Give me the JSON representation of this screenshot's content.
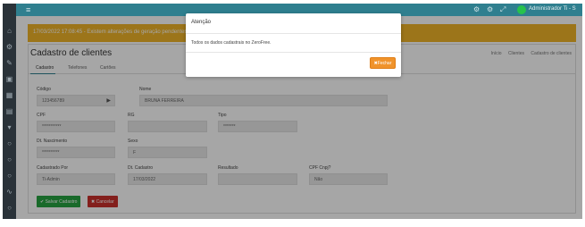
{
  "header": {
    "user_name": "Administrador Ti - S"
  },
  "banner": {
    "text": "17/03/2022 17:08:45 - Existem alterações de geração pendentes no sistema"
  },
  "page": {
    "title": "Cadastro de clientes",
    "breadcrumb": [
      "Início",
      "Clientes",
      "Cadastro de clientes"
    ]
  },
  "tabs": [
    "Cadastro",
    "Telefones",
    "Cartões"
  ],
  "form": {
    "codigo": {
      "label": "Código",
      "value": "123456789"
    },
    "nome": {
      "label": "Nome",
      "value": "BRUNA FERREIRA"
    },
    "cpf": {
      "label": "CPF",
      "value": "***********"
    },
    "rg": {
      "label": "RG",
      "value": ""
    },
    "tipo": {
      "label": "Tipo",
      "value": "*******"
    },
    "nascimento": {
      "label": "Dt. Nascimento",
      "value": "**********"
    },
    "sexo": {
      "label": "Sexo",
      "value": "F"
    },
    "cadastrado_por": {
      "label": "Cadastrado Por",
      "value": "Ti-Admin"
    },
    "dt_cadastro": {
      "label": "Dt. Cadastro",
      "value": "17/03/2022"
    },
    "resultado": {
      "label": "Resultado",
      "value": ""
    },
    "cpf_cnpj": {
      "label": "CPF Cnpj?",
      "value": "Não"
    }
  },
  "buttons": {
    "save": "Salvar Cadastro",
    "cancel": "Cancelar"
  },
  "modal": {
    "title": "Atenção",
    "body": "Todos os dados cadastrais no ZeroFree.",
    "close": "Fechar"
  },
  "colors": {
    "topbar": "#2f7f8f",
    "banner": "#f0b429",
    "save": "#27a341",
    "cancel": "#c9302c",
    "modal_button": "#f0932b"
  }
}
